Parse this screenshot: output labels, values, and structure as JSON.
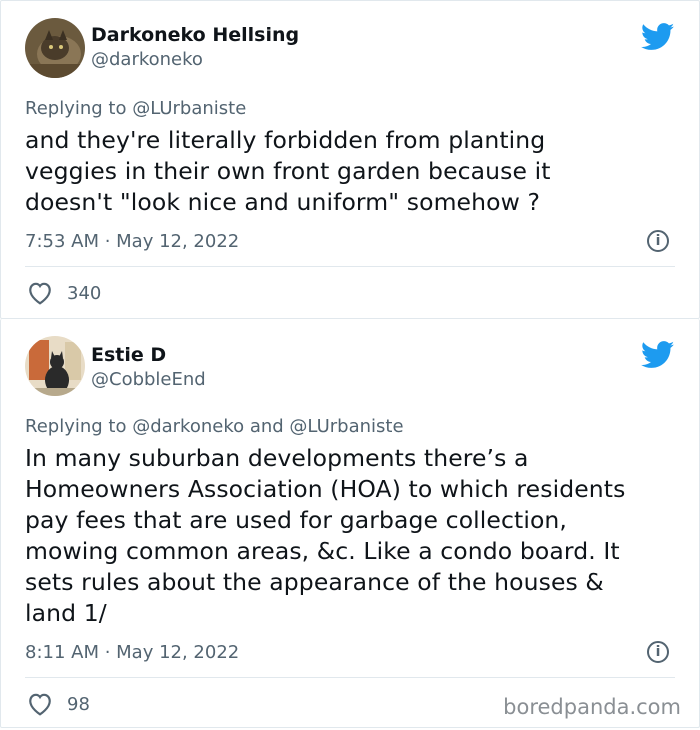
{
  "tweets": [
    {
      "name": "Darkoneko Hellsing",
      "handle": "@darkoneko",
      "replying": "Replying to @LUrbaniste",
      "body_lines": [
        "and they're literally forbidden from planting",
        "veggies in their own front garden because it",
        "doesn't \"look nice and uniform\" somehow ?"
      ],
      "timestamp": "7:53 AM · May 12, 2022",
      "likes": "340"
    },
    {
      "name": "Estie D",
      "handle": "@CobbleEnd",
      "replying": "Replying to @darkoneko and @LUrbaniste",
      "body_lines": [
        "In many suburban developments there’s a",
        "Homeowners Association (HOA) to which residents",
        "pay fees that are used for garbage collection,",
        "mowing common areas, &c. Like a condo board. It",
        "sets rules about the appearance of the houses &",
        "land 1/"
      ],
      "timestamp": "8:11 AM · May 12, 2022",
      "likes": "98"
    }
  ],
  "watermark": "boredpanda.com",
  "icons": {
    "brand": "twitter-bird-icon",
    "info": "info-icon",
    "like": "heart-icon"
  },
  "colors": {
    "twitter_blue": "#1d9bf0",
    "secondary_text": "#536471",
    "divider": "#e1e8ed"
  }
}
